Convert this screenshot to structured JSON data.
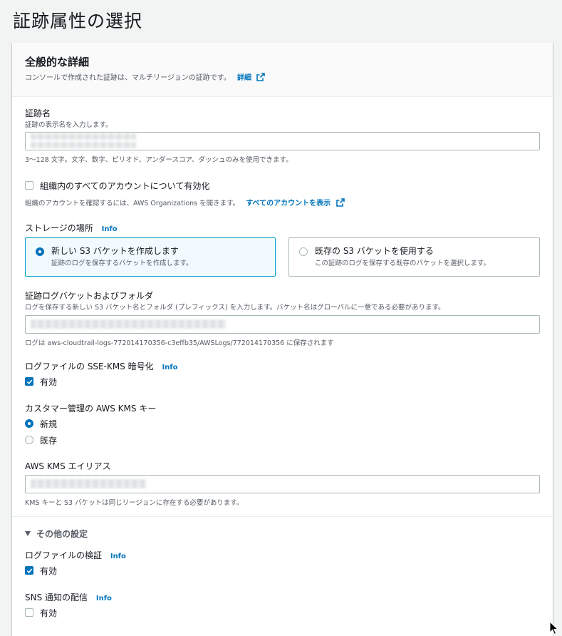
{
  "page": {
    "title": "証跡属性の選択"
  },
  "general": {
    "title": "全般的な詳細",
    "description": "コンソールで作成された証跡は、マルチリージョンの証跡です。",
    "details_link": "詳細"
  },
  "trail_name": {
    "label": "証跡名",
    "description": "証跡の表示名を入力します。",
    "value": "",
    "hint": "3〜128 文字。文字、数字、ピリオド、アンダースコア、ダッシュのみを使用できます。"
  },
  "org": {
    "checkbox_label": "組織内のすべてのアカウントについて有効化",
    "checked": false,
    "hint": "組織のアカウントを確認するには、AWS Organizations を開きます。",
    "link": "すべてのアカウントを表示"
  },
  "storage": {
    "label": "ストレージの場所",
    "info": "Info",
    "options": [
      {
        "title": "新しい S3 バケットを作成します",
        "desc": "証跡のログを保存するバケットを作成します。",
        "selected": true
      },
      {
        "title": "既存の S3 バケットを使用する",
        "desc": "この証跡のログを保存する既存のバケットを選択します。",
        "selected": false
      }
    ]
  },
  "bucket": {
    "label": "証跡ログバケットおよびフォルダ",
    "description": "ログを保存する新しい S3 バケット名とフォルダ (プレフィックス) を入力します。バケット名はグローバルに一意である必要があります。",
    "value": "",
    "hint": "ログは aws-cloudtrail-logs-772014170356-c3effb35/AWSLogs/772014170356 に保存されます"
  },
  "sse": {
    "label": "ログファイルの SSE-KMS 暗号化",
    "info": "Info",
    "checkbox_label": "有効",
    "checked": true
  },
  "kms": {
    "label": "カスタマー管理の AWS KMS キー",
    "options": [
      {
        "label": "新規",
        "selected": true
      },
      {
        "label": "既存",
        "selected": false
      }
    ]
  },
  "alias": {
    "label": "AWS KMS エイリアス",
    "value": "",
    "hint": "KMS キーと S3 バケットは同じリージョンに存在する必要があります。"
  },
  "other": {
    "toggle_label": "その他の設定",
    "validation": {
      "label": "ログファイルの検証",
      "info": "Info",
      "checkbox_label": "有効",
      "checked": true
    },
    "sns": {
      "label": "SNS 通知の配信",
      "info": "Info",
      "checkbox_label": "有効",
      "checked": false
    }
  },
  "colors": {
    "accent": "#0073bb",
    "tile_selected_border": "#00a1c9",
    "tile_selected_bg": "#f1faff"
  }
}
